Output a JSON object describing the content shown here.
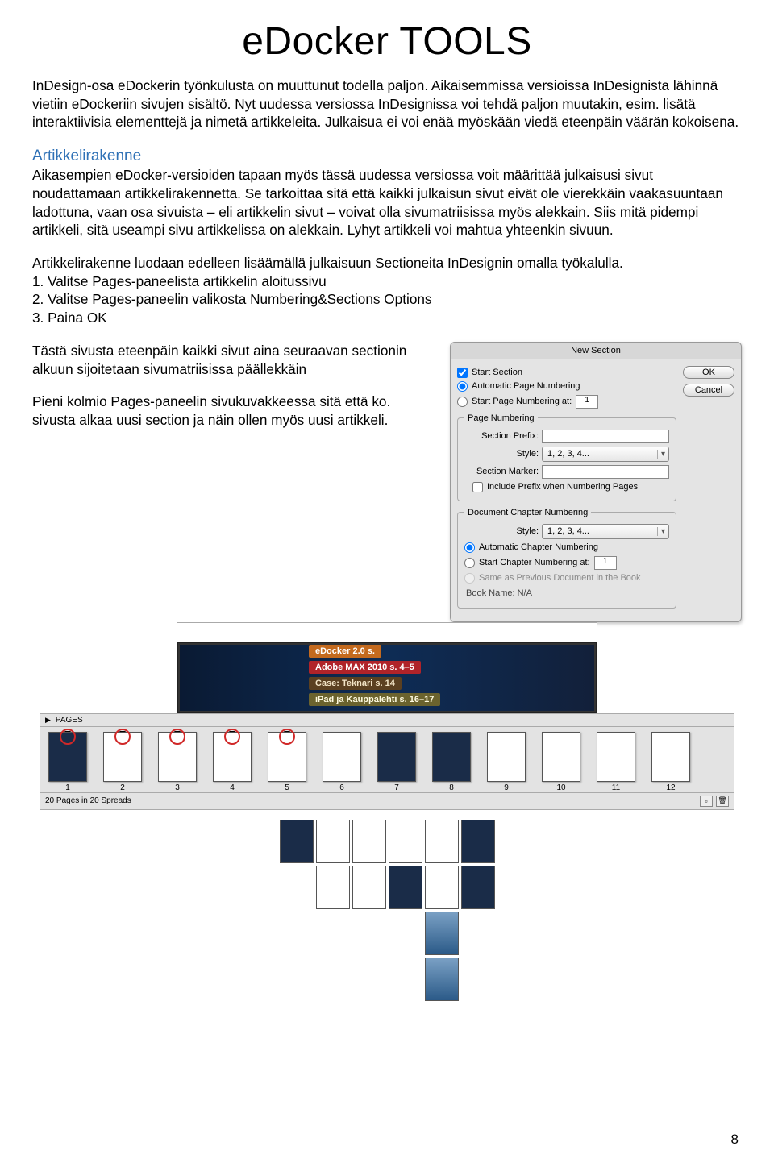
{
  "title": "eDocker TOOLS",
  "intro_p1": "InDesign-osa eDockerin työnkulusta on muuttunut todella paljon. Aikaisemmissa versioissa InDesignista lähinnä vietiin eDockeriin sivujen sisältö. Nyt uudessa versiossa InDesignissa voi tehdä paljon muutakin, esim. lisätä interaktiivisia elementtejä ja nimetä artikkeleita. Julkaisua ei voi enää myöskään viedä eteenpäin väärän kokoisena.",
  "section_head": "Artikkelirakenne",
  "para_body": "Aikasempien eDocker-versioiden tapaan myös tässä uudessa versiossa voit määrittää julkaisusi sivut noudattamaan artikkelirakennetta. Se tarkoittaa sitä että kaikki julkaisun sivut eivät ole vierekkäin vaakasuuntaan ladottuna, vaan osa sivuista – eli artikkelin sivut – voivat olla sivumatriisissa myös alekkain. Siis mitä pidempi artikkeli, sitä useampi sivu artikkelissa on alekkain. Lyhyt artikkeli voi mahtua yhteenkin sivuun.",
  "steps_intro": "Artikkelirakenne luodaan edelleen lisäämällä julkaisuun Sectioneita InDesignin omalla työkalulla.",
  "steps": [
    "1. Valitse Pages-paneelista artikkelin aloitussivu",
    "2. Valitse Pages-paneelin valikosta Numbering&Sections Options",
    "3. Paina OK"
  ],
  "left_p1": "Tästä sivusta eteenpäin kaikki sivut aina seuraavan sectionin alkuun sijoitetaan sivumatriisissa päällekkäin",
  "left_p2": "Pieni kolmio Pages-paneelin sivukuvakkeessa sitä että ko. sivusta alkaa uusi section ja näin ollen myös uusi artikkeli.",
  "dialog": {
    "title": "New Section",
    "ok": "OK",
    "cancel": "Cancel",
    "start_section": "Start Section",
    "auto_num": "Automatic Page Numbering",
    "start_num": "Start Page Numbering at:",
    "start_num_val": "1",
    "page_numbering": "Page Numbering",
    "section_prefix": "Section Prefix:",
    "style_label": "Style:",
    "style_val": "1, 2, 3, 4...",
    "section_marker": "Section Marker:",
    "include_prefix": "Include Prefix when Numbering Pages",
    "doc_chapter": "Document Chapter Numbering",
    "chap_style_val": "1, 2, 3, 4...",
    "auto_chap": "Automatic Chapter Numbering",
    "start_chap": "Start Chapter Numbering at:",
    "start_chap_val": "1",
    "same_prev": "Same as Previous Document in the Book",
    "book_name": "Book Name: N/A"
  },
  "cover": {
    "s1": "eDocker 2.0 s.",
    "s2": "Adobe MAX 2010 s. 4–5",
    "s3": "Case: Teknari s. 14",
    "s4": "iPad ja Kauppalehti s. 16–17"
  },
  "panel": {
    "tab": "PAGES",
    "count": "20 Pages in 20 Spreads",
    "nums": [
      "1",
      "2",
      "3",
      "4",
      "5",
      "6",
      "7",
      "8",
      "9",
      "10",
      "11",
      "12"
    ]
  },
  "page_number": "8"
}
